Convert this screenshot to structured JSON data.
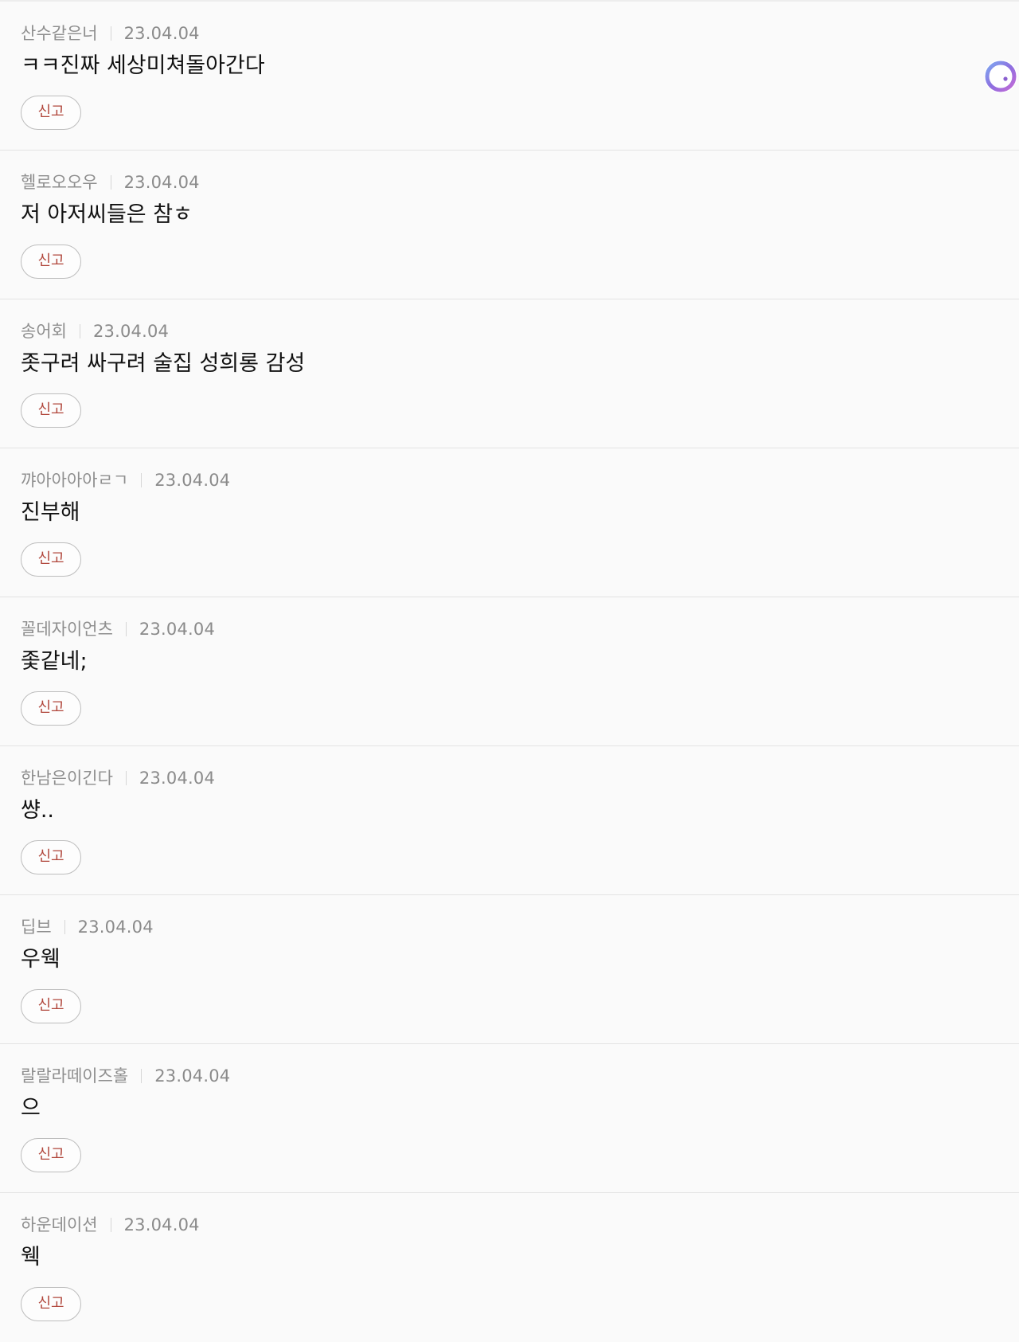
{
  "comments": [
    {
      "author": "산수같은너",
      "date": "23.04.04",
      "text": "ㅋㅋ진짜 세상미쳐돌아간다",
      "report_label": "신고"
    },
    {
      "author": "헬로오오우",
      "date": "23.04.04",
      "text": "저 아저씨들은 참ㅎ",
      "report_label": "신고"
    },
    {
      "author": "송어회",
      "date": "23.04.04",
      "text": "좃구려 싸구려 술집 성희롱 감성",
      "report_label": "신고"
    },
    {
      "author": "꺄아아아아ㄹㄱ",
      "date": "23.04.04",
      "text": "진부해",
      "report_label": "신고"
    },
    {
      "author": "꼴데자이언츠",
      "date": "23.04.04",
      "text": "좇같네;",
      "report_label": "신고"
    },
    {
      "author": "한남은이긴다",
      "date": "23.04.04",
      "text": "썅..",
      "report_label": "신고"
    },
    {
      "author": "딥브",
      "date": "23.04.04",
      "text": "우웩",
      "report_label": "신고"
    },
    {
      "author": "랄랄라떼이즈홀",
      "date": "23.04.04",
      "text": "으",
      "report_label": "신고"
    },
    {
      "author": "하운데이션",
      "date": "23.04.04",
      "text": "웩",
      "report_label": "신고"
    }
  ],
  "colors": {
    "report_text": "#b0453a",
    "meta_text": "#8e8e8e",
    "body_text": "#111111",
    "background": "#fafafa"
  },
  "floating_widget": {
    "icon": "assistant-ring-icon"
  }
}
